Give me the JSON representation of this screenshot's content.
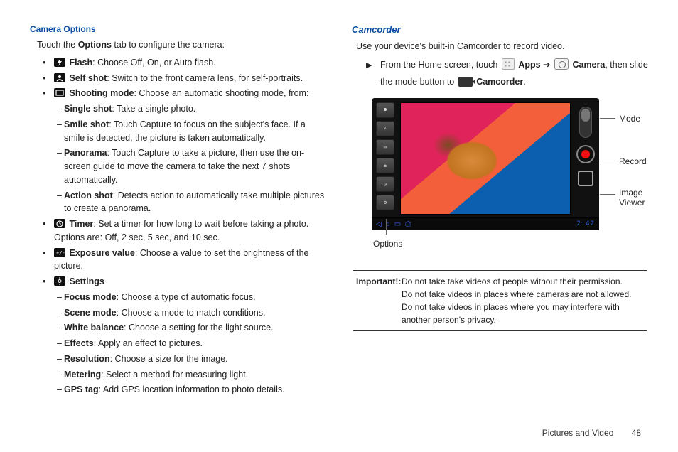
{
  "left": {
    "header": "Camera Options",
    "intro_a": "Touch the ",
    "intro_b": "Options",
    "intro_c": " tab to configure the camera:",
    "flash_b": "Flash",
    "flash_t": ": Choose Off, On, or Auto flash.",
    "self_b": "Self shot",
    "self_t": ": Switch to the front camera lens, for self-portraits.",
    "shoot_b": "Shooting mode",
    "shoot_t": ": Choose an automatic shooting mode, from:",
    "single_b": "Single shot",
    "single_t": ": Take a single photo.",
    "smile_b": "Smile shot",
    "smile_t": ": Touch Capture to focus on the subject's face. If a smile is detected, the picture is taken automatically.",
    "pano_b": "Panorama",
    "pano_t": ": Touch Capture to take a picture, then use the on-screen guide to move the camera to take the next 7 shots automatically.",
    "action_b": "Action shot",
    "action_t": ": Detects action to automatically take multiple pictures to create a panorama.",
    "timer_b": "Timer",
    "timer_t": ": Set a timer for how long to wait before taking a photo. Options are: Off, 2 sec, 5 sec, and 10 sec.",
    "expo_b": "Exposure value",
    "expo_t": ": Choose a value to set the brightness of the picture.",
    "settings_b": "Settings",
    "focus_b": "Focus mode",
    "focus_t": ": Choose a type of automatic focus.",
    "scene_b": "Scene mode",
    "scene_t": ": Choose a mode to match conditions.",
    "wb_b": "White balance",
    "wb_t": ": Choose a setting for the light source.",
    "fx_b": "Effects",
    "fx_t": ": Apply an effect to pictures.",
    "res_b": "Resolution",
    "res_t": ": Choose a size for the image.",
    "meter_b": "Metering",
    "meter_t": ": Select a method for measuring light.",
    "gps_b": "GPS tag",
    "gps_t": ": Add GPS location information to photo details."
  },
  "right": {
    "header": "Camcorder",
    "intro": "Use your device's built-in Camcorder to record video.",
    "step_a": "From the Home screen, touch ",
    "apps_b": "Apps",
    "arrow": " ➔ ",
    "camera_b": "Camera",
    "step_b": ", then slide the mode button to ",
    "camcorder_b": "Camcorder",
    "period": ".",
    "label_mode": "Mode",
    "label_record": "Record",
    "label_viewer1": "Image",
    "label_viewer2": "Viewer",
    "label_options": "Options",
    "clock": "2:42",
    "important_h": "Important!: ",
    "important_1": "Do not take take videos of people without their permission.",
    "important_2": "Do not take videos in places where cameras are not allowed.",
    "important_3": "Do not take videos in places where you may interfere with another person's privacy."
  },
  "footer": {
    "section": "Pictures and Video",
    "page": "48"
  }
}
